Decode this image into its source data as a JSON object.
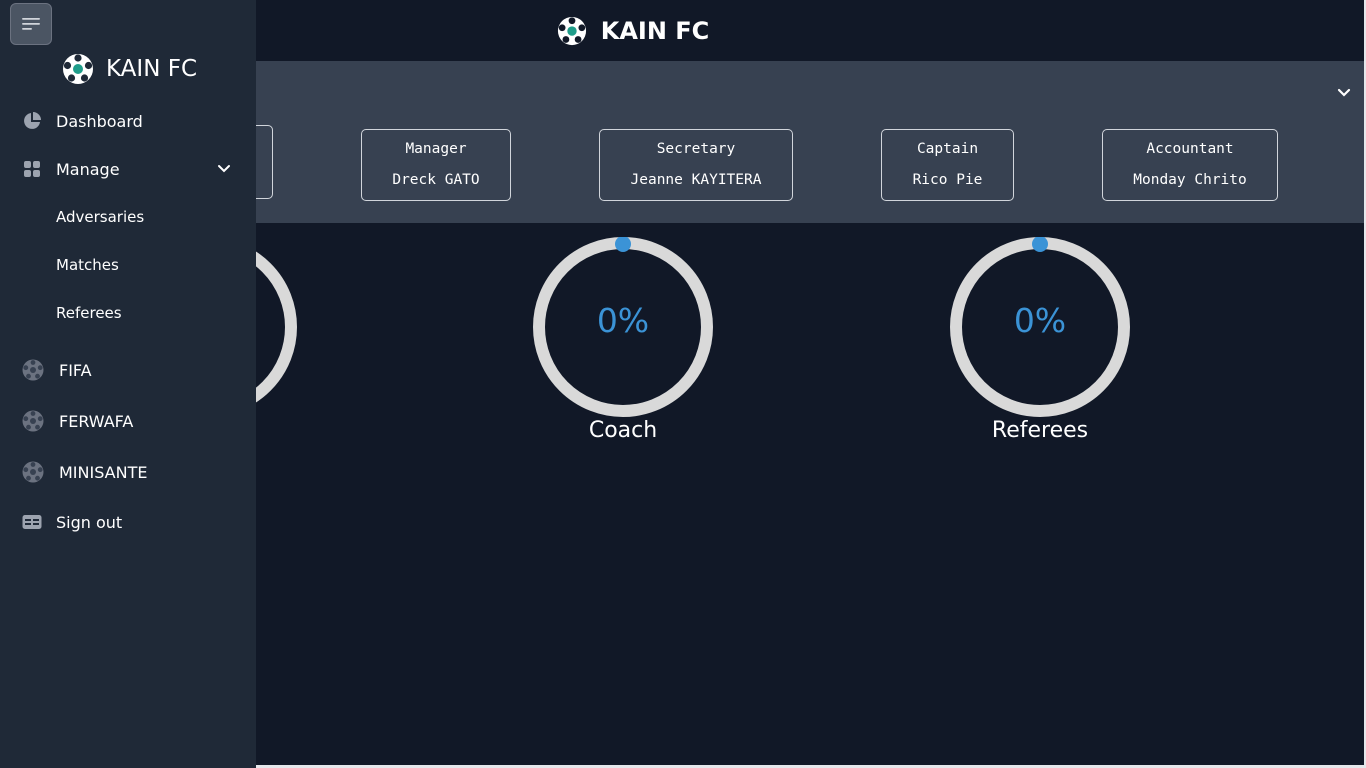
{
  "app": {
    "title": "KAIN FC"
  },
  "sidebar": {
    "brand": "KAIN FC",
    "items": [
      {
        "label": "Dashboard",
        "icon": "pie-chart-icon"
      },
      {
        "label": "Manage",
        "icon": "grid-icon",
        "expanded": true
      },
      {
        "label": "Adversaries"
      },
      {
        "label": "Matches"
      },
      {
        "label": "Referees"
      },
      {
        "label": "FIFA",
        "icon": "soccer-ball-icon"
      },
      {
        "label": "FERWAFA",
        "icon": "soccer-ball-icon"
      },
      {
        "label": "MINISANTE",
        "icon": "soccer-ball-icon"
      },
      {
        "label": "Sign out",
        "icon": "id-card-icon"
      }
    ]
  },
  "staff": [
    {
      "role": "Manager",
      "name": "Dreck GATO"
    },
    {
      "role": "Secretary",
      "name": "Jeanne KAYITERA"
    },
    {
      "role": "Captain",
      "name": "Rico Pie"
    },
    {
      "role": "Accountant",
      "name": "Monday Chrito"
    }
  ],
  "gauges": [
    {
      "value": "0%",
      "label": "Coach",
      "fraction": 0
    },
    {
      "value": "0%",
      "label": "Referees",
      "fraction": 0
    }
  ],
  "colors": {
    "background": "#111827",
    "sidebar": "#1f2937",
    "staff_bar": "#374151",
    "accent": "#3b93d6",
    "ring": "#d9d9d9"
  }
}
